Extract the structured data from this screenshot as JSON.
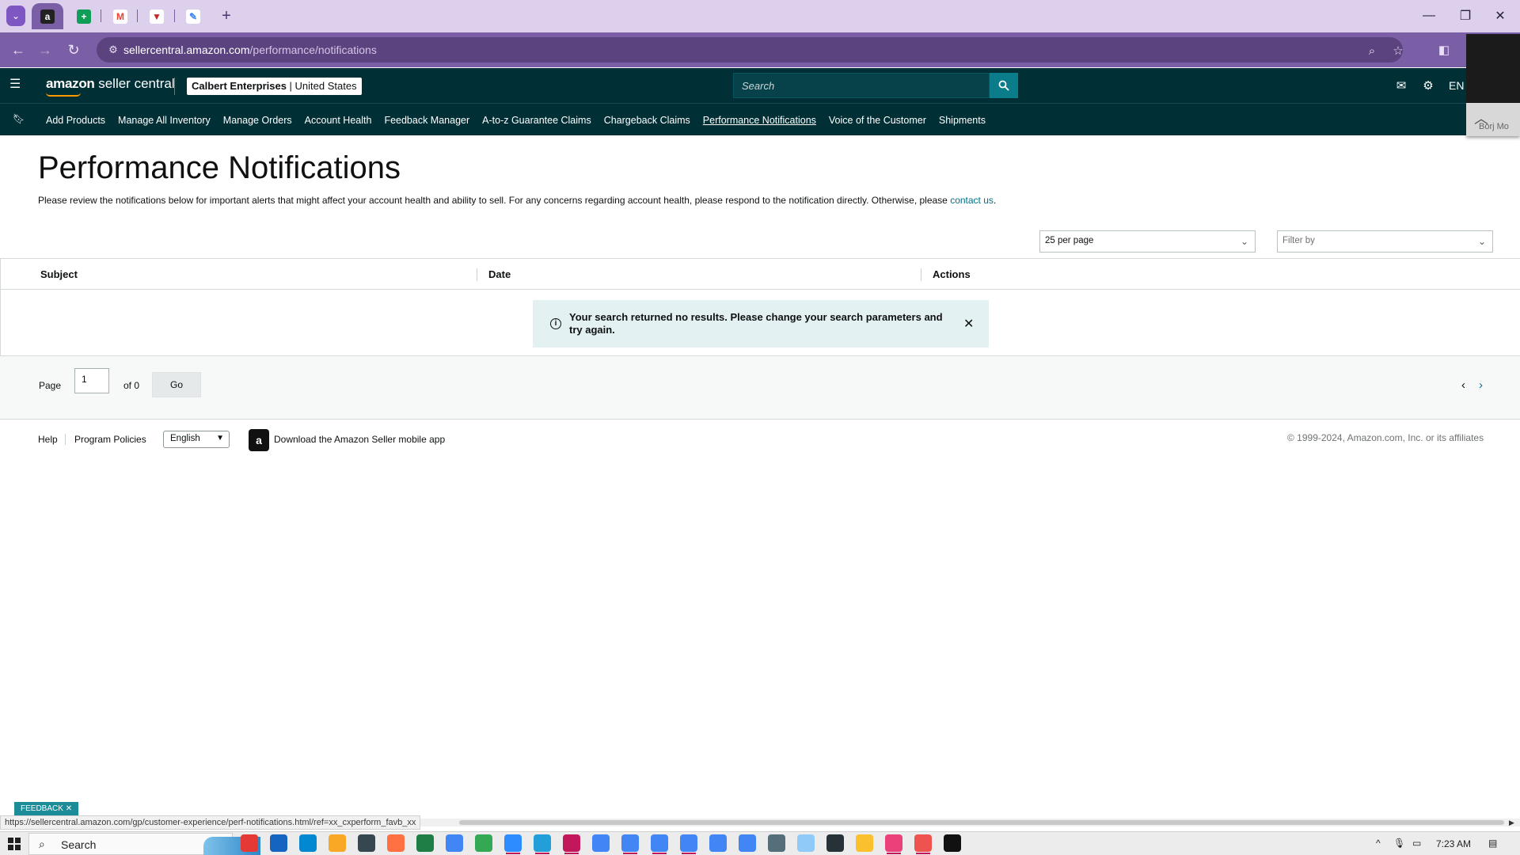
{
  "browser": {
    "tabs": [
      {
        "name": "amazon",
        "color": "#222222",
        "glyph": "a"
      },
      {
        "name": "sheets",
        "color": "#0f9d58",
        "glyph": "+"
      },
      {
        "name": "gmail",
        "color": "#ea4335",
        "glyph": "M"
      },
      {
        "name": "todoist",
        "color": "#c62828",
        "glyph": "▼"
      },
      {
        "name": "pen-tool",
        "color": "#4285f4",
        "glyph": "✎"
      }
    ],
    "url_host": "sellercentral.amazon.com",
    "url_path": "/performance/notifications",
    "status_url": "https://sellercentral.amazon.com/gp/customer-experience/perf-notifications.html/ref=xx_cxperform_favb_xx",
    "overlay_text": "Borj Mo"
  },
  "header": {
    "logo_bold": "amazon",
    "logo_rest": " seller central",
    "account_name": "Calbert Enterprises",
    "account_region": "United States",
    "search_placeholder": "Search",
    "language": "EN"
  },
  "nav": {
    "items": [
      {
        "label": "Add Products",
        "active": false
      },
      {
        "label": "Manage All Inventory",
        "active": false
      },
      {
        "label": "Manage Orders",
        "active": false
      },
      {
        "label": "Account Health",
        "active": false
      },
      {
        "label": "Feedback Manager",
        "active": false
      },
      {
        "label": "A-to-z Guarantee Claims",
        "active": false
      },
      {
        "label": "Chargeback Claims",
        "active": false
      },
      {
        "label": "Performance Notifications",
        "active": true
      },
      {
        "label": "Voice of the Customer",
        "active": false
      },
      {
        "label": "Shipments",
        "active": false
      }
    ]
  },
  "main": {
    "title": "Performance Notifications",
    "description": "Please review the notifications below for important alerts that might affect your account health and ability to sell. For any concerns regarding account health, please respond to the notification directly. Otherwise, please ",
    "contact_link": "contact us",
    "per_page": "25 per page",
    "filter_placeholder": "Filter by",
    "columns": {
      "subject": "Subject",
      "date": "Date",
      "actions": "Actions"
    },
    "alert_text": "Your search returned no results. Please change your search parameters and try again."
  },
  "pager": {
    "page_label": "Page",
    "current_page": "1",
    "of_label": "of 0",
    "go_label": "Go"
  },
  "footer": {
    "help": "Help",
    "policies": "Program Policies",
    "language_select": "English",
    "app_link": "Download the Amazon Seller mobile app",
    "copyright": "© 1999-2024, Amazon.com, Inc. or its affiliates",
    "feedback": "FEEDBACK"
  },
  "taskbar": {
    "search_text": "Search",
    "clock": "7:23 AM",
    "apps": [
      "#e53935",
      "#1565c0",
      "#0288d1",
      "#f9a825",
      "#37474f",
      "#ff7043",
      "#1e7e45",
      "#4285f4",
      "#34a853",
      "#2d8cff",
      "#229ed9",
      "#c2185b",
      "#4285f4",
      "#4285f4",
      "#4285f4",
      "#4285f4",
      "#4285f4",
      "#4285f4",
      "#546e7a",
      "#90caf9",
      "#263238",
      "#fbc02d",
      "#ec407a",
      "#ef5350",
      "#111111"
    ]
  }
}
